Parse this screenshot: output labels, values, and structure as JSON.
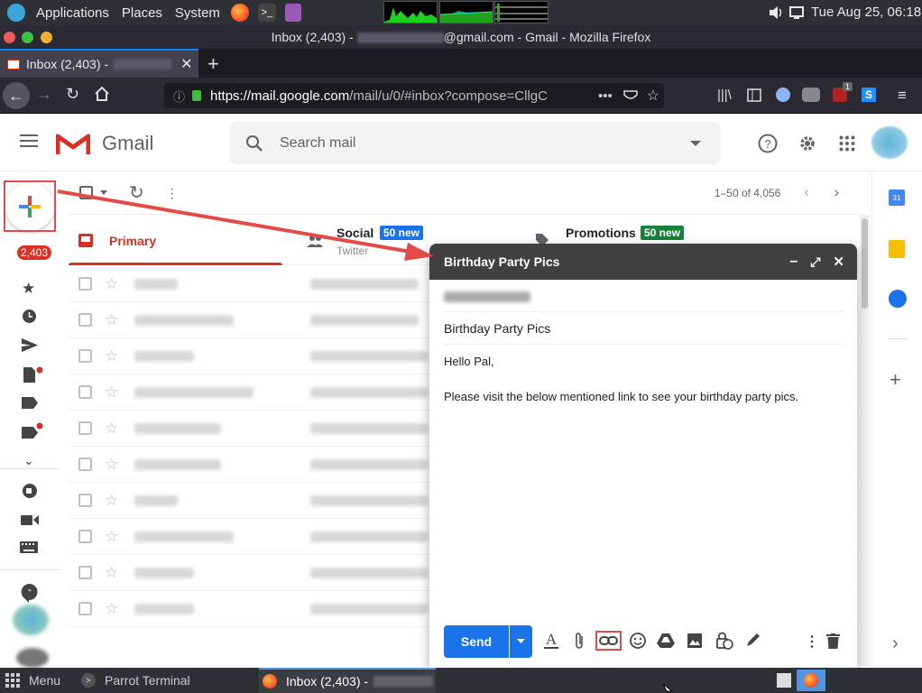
{
  "desktop": {
    "menu": [
      "Applications",
      "Places",
      "System"
    ],
    "clock": "Tue Aug 25, 06:18"
  },
  "window": {
    "title_prefix": "Inbox (2,403) -",
    "title_suffix": "@gmail.com - Gmail - Mozilla Firefox"
  },
  "browser": {
    "tab_label": "Inbox (2,403) -",
    "url_host": "https://mail.google.com",
    "url_path": "/mail/u/0/#inbox?compose=CllgC",
    "ext_badge": "1"
  },
  "gmail": {
    "logo_text": "Gmail",
    "search_placeholder": "Search mail",
    "inbox_count": "2,403",
    "pagination": "1–50 of 4,056",
    "tabs": [
      {
        "label": "Primary"
      },
      {
        "label": "Social",
        "badge": "50 new",
        "sub": "Twitter"
      },
      {
        "label": "Promotions",
        "badge": "50 new"
      }
    ]
  },
  "compose": {
    "title": "Birthday Party Pics",
    "subject": "Birthday Party Pics",
    "greeting": "Hello Pal,",
    "body": "Please visit the below mentioned link to see your birthday party pics.",
    "send_label": "Send"
  },
  "taskbar": {
    "menu_label": "Menu",
    "terminal_label": "Parrot Terminal",
    "firefox_label": "Inbox (2,403) -"
  },
  "colors": {
    "gmail_red": "#d93025",
    "send_blue": "#1a73e8",
    "badge_blue": "#1a73e8",
    "badge_green": "#188038",
    "annotation_red": "#e34b4b"
  }
}
